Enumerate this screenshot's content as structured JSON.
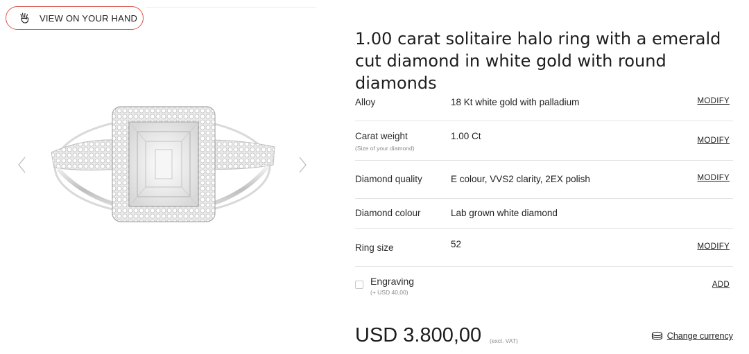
{
  "gallery": {
    "view_on_hand_label": "VIEW ON YOUR HAND",
    "hand_icon": "hand-gesture-icon",
    "prev_icon": "chevron-left-icon",
    "next_icon": "chevron-right-icon",
    "accent_color": "#d9544a"
  },
  "product": {
    "title": "1.00 carat solitaire halo ring with a emerald cut diamond in white gold with round diamonds"
  },
  "specs": {
    "alloy": {
      "label": "Alloy",
      "value": "18 Kt white gold with palladium",
      "action": "MODIFY"
    },
    "carat": {
      "label": "Carat weight",
      "sublabel": "(Size of your diamond)",
      "value": "1.00 Ct",
      "action": "MODIFY"
    },
    "quality": {
      "label": "Diamond quality",
      "value": "E colour, VVS2 clarity, 2EX polish",
      "action": "MODIFY"
    },
    "colour": {
      "label": "Diamond colour",
      "value": "Lab grown white diamond"
    },
    "size": {
      "label": "Ring size",
      "value": "52",
      "action": "MODIFY"
    },
    "engraving": {
      "label": "Engraving",
      "sublabel": "(+ USD 40,00)",
      "action": "ADD",
      "checked": false
    }
  },
  "pricing": {
    "price": "USD 3.800,00",
    "excl": "(excl. VAT)",
    "currency_label": "Change currency",
    "currency_icon": "coins-icon"
  }
}
